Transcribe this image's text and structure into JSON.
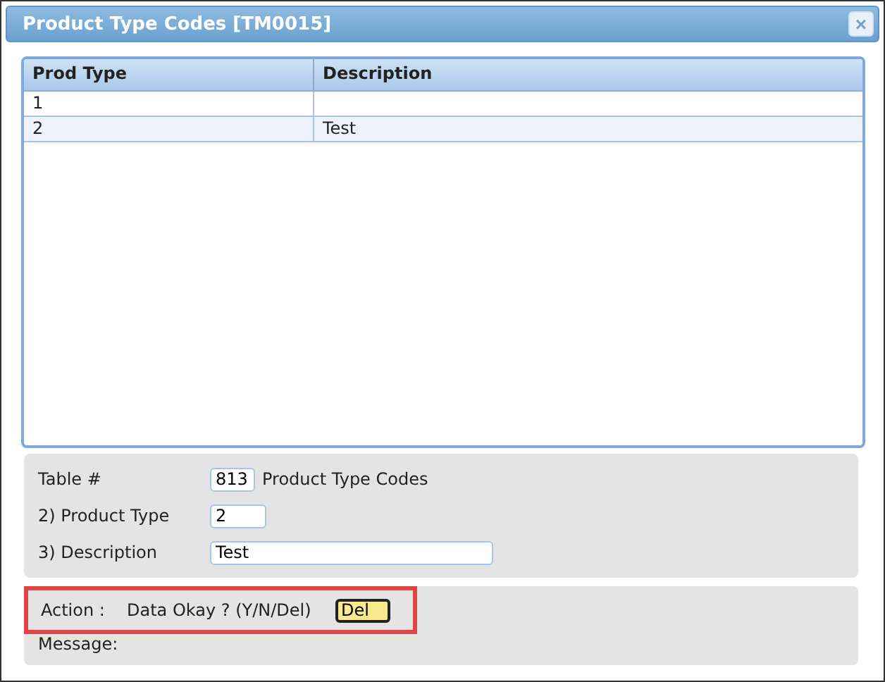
{
  "window": {
    "title": "Product Type Codes [TM0015]",
    "close": "×"
  },
  "table": {
    "columns": [
      "Prod Type",
      "Description"
    ],
    "rows": [
      {
        "cells": [
          "1",
          ""
        ],
        "selected": false
      },
      {
        "cells": [
          "2",
          "Test"
        ],
        "selected": true
      }
    ]
  },
  "form": {
    "fields": [
      {
        "label": "Table #",
        "value": "813",
        "suffix": "Product Type Codes"
      },
      {
        "label": "2) Product Type",
        "value": "2"
      },
      {
        "label": "3) Description",
        "value": "Test"
      }
    ]
  },
  "action": {
    "label": "Action :",
    "prompt": "Data Okay ? (Y/N/Del)",
    "value": "Del",
    "highlighted": true,
    "message_label": "Message:"
  }
}
